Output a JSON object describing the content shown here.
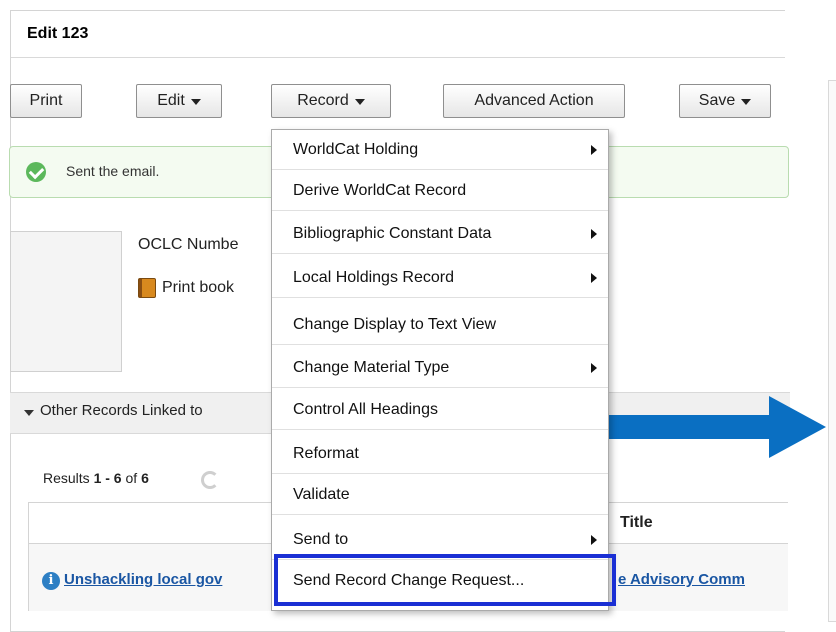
{
  "window": {
    "title": "Edit 123"
  },
  "toolbar": {
    "print": "Print",
    "edit": "Edit",
    "record": "Record",
    "advanced_action": "Advanced Action",
    "save": "Save"
  },
  "alert": {
    "text": "Sent the email."
  },
  "record": {
    "oclc_label": "OCLC Numbe",
    "format": "Print book"
  },
  "section": {
    "label": "Other Records Linked to"
  },
  "results": {
    "prefix": "Results ",
    "range": "1 - 6",
    "of": " of ",
    "total": "6",
    "column_title": "Title",
    "row1_link_left": "Unshackling local gov",
    "row1_link_right": "e Advisory Comm"
  },
  "menu": {
    "items": [
      {
        "label": "WorldCat Holding",
        "submenu": true
      },
      {
        "label": "Derive WorldCat Record",
        "submenu": false
      },
      {
        "label": "Bibliographic Constant Data",
        "submenu": true
      },
      {
        "label": "Local Holdings Record",
        "submenu": true
      },
      {
        "label": "Change Display to Text View",
        "submenu": false
      },
      {
        "label": "Change Material Type",
        "submenu": true
      },
      {
        "label": "Control All Headings",
        "submenu": false
      },
      {
        "label": "Reformat",
        "submenu": false
      },
      {
        "label": "Validate",
        "submenu": false
      },
      {
        "label": "Send to",
        "submenu": true
      },
      {
        "label": "Send Record Change Request...",
        "submenu": false
      }
    ],
    "highlighted_item": "Send Record Change Request..."
  },
  "colors": {
    "accent_arrow": "#0a6fc2",
    "highlight_border": "#1a2fd4",
    "success": "#5cb85c",
    "link": "#1a56a3"
  }
}
